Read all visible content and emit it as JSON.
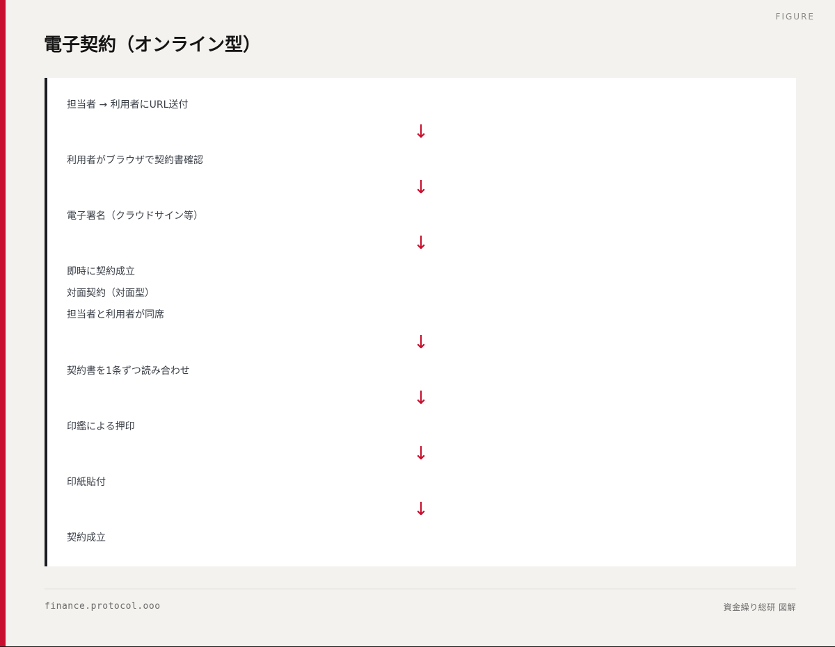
{
  "figure_label": "FIGURE",
  "title": "電子契約（オンライン型）",
  "flow": {
    "lines": [
      "担当者 → 利用者にURL送付",
      "利用者がブラウザで契約書確認",
      "電子署名（クラウドサイン等）",
      "即時に契約成立",
      "対面契約（対面型）",
      "担当者と利用者が同席",
      "契約書を1条ずつ読み合わせ",
      "印鑑による押印",
      "印紙貼付",
      "契約成立"
    ],
    "arrow_glyph": "↓",
    "arrow_color": "#c8102e"
  },
  "footer": {
    "site": "finance.protocol.ooo",
    "credit": "資金繰り総研 図解"
  },
  "colors": {
    "accent": "#c8102e",
    "background": "#f4f2ee",
    "panel": "#ffffff",
    "panel_border": "#1a1d22"
  }
}
